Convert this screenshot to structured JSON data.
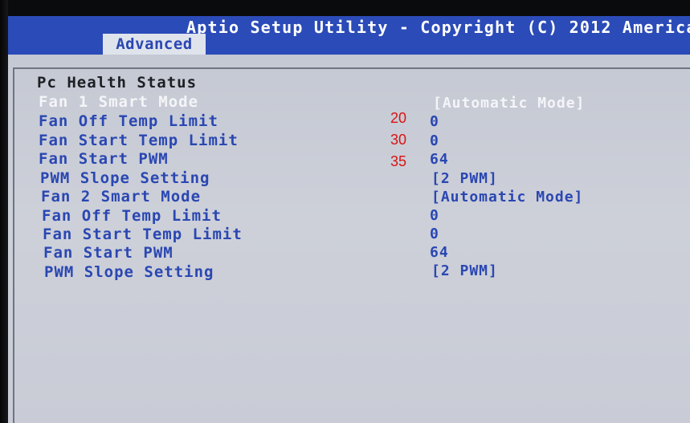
{
  "header": {
    "title": "Aptio Setup Utility - Copyright (C) 2012 America",
    "active_tab": "Advanced"
  },
  "section": {
    "title": "Pc Health Status"
  },
  "settings": [
    {
      "label": "Fan 1 Smart Mode",
      "value": "[Automatic Mode]",
      "selected": true
    },
    {
      "label": "Fan Off Temp Limit",
      "value": "0"
    },
    {
      "label": "Fan Start Temp Limit",
      "value": "0"
    },
    {
      "label": "Fan Start PWM",
      "value": "64"
    },
    {
      "label": "PWM Slope Setting",
      "value": "[2 PWM]"
    },
    {
      "label": "Fan 2 Smart Mode",
      "value": "[Automatic Mode]"
    },
    {
      "label": "Fan Off Temp Limit",
      "value": "0"
    },
    {
      "label": "Fan Start Temp Limit",
      "value": "0"
    },
    {
      "label": "Fan Start PWM",
      "value": "64"
    },
    {
      "label": "PWM Slope Setting",
      "value": "[2 PWM]"
    }
  ],
  "annotations": [
    "20",
    "30",
    "35"
  ],
  "colors": {
    "title_bar": "#2b4bb8",
    "panel": "#c9ccd6",
    "item_text": "#2a47b2",
    "selected_text": "#f4f5f8",
    "annotation": "#d81414"
  }
}
